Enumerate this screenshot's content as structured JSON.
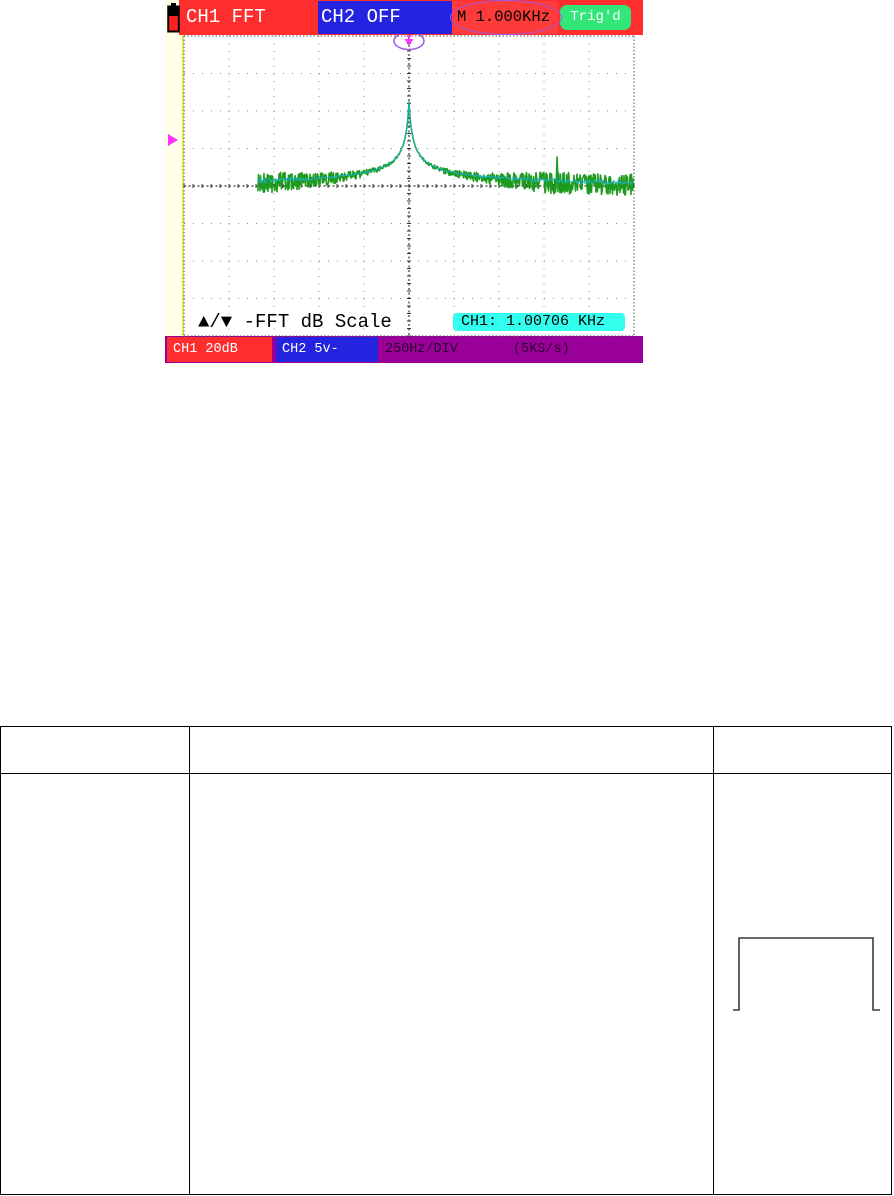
{
  "scope": {
    "top_bar": {
      "ch1_mode": "CH1 FFT",
      "ch2_mode": "CH2 OFF",
      "timebase": "M 1.000KHz",
      "trigger_status": "Trig'd"
    },
    "hint": "▲/▼ -FFT dB Scale",
    "frequency_readout": "CH1: 1.00706 KHz",
    "bottom_bar": {
      "ch1_scale": "CH1 20dB",
      "ch2_scale": "CH2 5v-",
      "horizontal_scale": "250Hz/DIV",
      "sample_rate": "(5KS/s)"
    },
    "icons": {
      "battery": "battery-icon",
      "trigger_position": "trigger-position-arrow-icon",
      "channel_marker": "channel-marker-triangle-icon"
    },
    "colors": {
      "ch1": "#ff2e2e",
      "ch2": "#2323e0",
      "trigger": "#33e67a",
      "readout": "#33ffee",
      "status_bar": "#990099",
      "marker": "#ff33ff",
      "highlight": "#9b59e8",
      "trace": "#1e9b1e",
      "trace_core": "#19b4d2"
    }
  },
  "table": {
    "icons": {
      "window_shape": "rectangular-window-icon"
    }
  }
}
